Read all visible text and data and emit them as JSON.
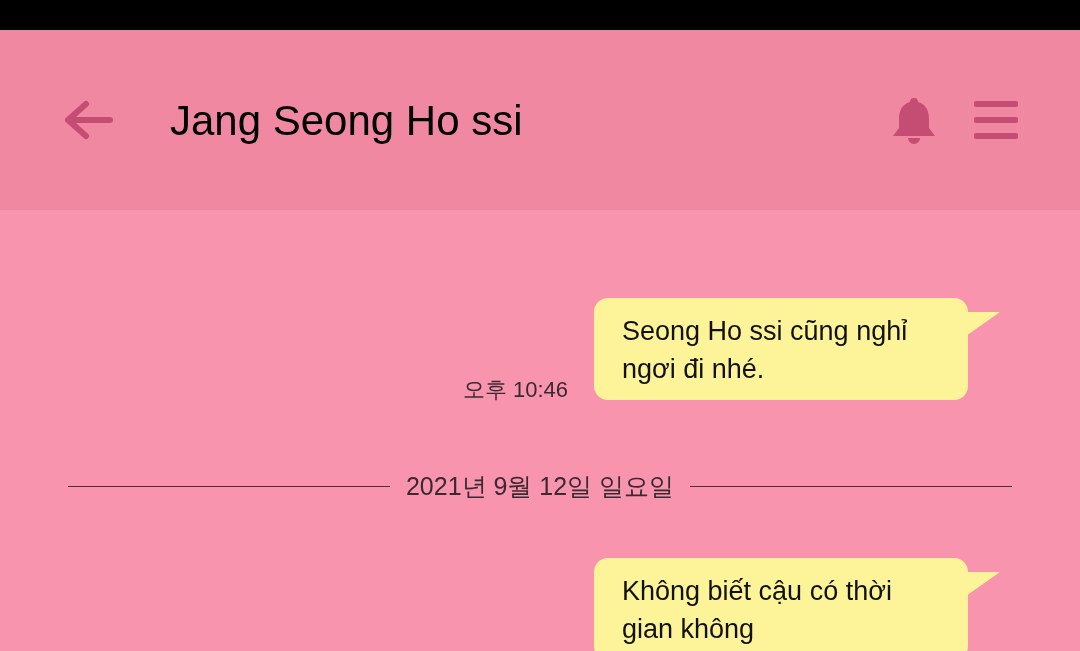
{
  "header": {
    "title": "Jang Seong Ho ssi"
  },
  "messages": [
    {
      "kind": "message",
      "text": "Seong Ho ssi cũng nghỉ ngơi đi nhé.",
      "time": "오후 10:46"
    },
    {
      "kind": "date",
      "text": "2021년 9월 12일 일요일"
    },
    {
      "kind": "message",
      "text": "Không biết cậu có thời gian không"
    }
  ]
}
